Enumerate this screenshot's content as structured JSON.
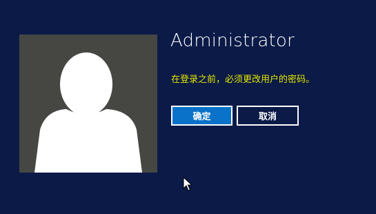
{
  "user": {
    "name": "Administrator",
    "avatar_icon": "user-silhouette-icon"
  },
  "message": "在登录之前，必须更改用户的密码。",
  "buttons": {
    "ok_label": "确定",
    "cancel_label": "取消"
  },
  "colors": {
    "background": "#0b1a47",
    "message_text": "#e4e600",
    "ok_button_fill": "#0a72c9",
    "avatar_background": "#464743"
  }
}
